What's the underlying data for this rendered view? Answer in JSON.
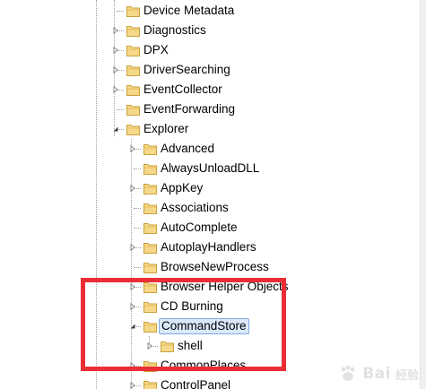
{
  "tree": {
    "top_level_items": [
      {
        "label": "Device Metadata",
        "expander": "none"
      },
      {
        "label": "Diagnostics",
        "expander": "collapsed"
      },
      {
        "label": "DPX",
        "expander": "collapsed"
      },
      {
        "label": "DriverSearching",
        "expander": "collapsed"
      },
      {
        "label": "EventCollector",
        "expander": "collapsed"
      },
      {
        "label": "EventForwarding",
        "expander": "none"
      },
      {
        "label": "Explorer",
        "expander": "expanded"
      }
    ],
    "explorer_children": [
      {
        "label": "Advanced",
        "expander": "collapsed"
      },
      {
        "label": "AlwaysUnloadDLL",
        "expander": "none"
      },
      {
        "label": "AppKey",
        "expander": "collapsed"
      },
      {
        "label": "Associations",
        "expander": "none"
      },
      {
        "label": "AutoComplete",
        "expander": "none"
      },
      {
        "label": "AutoplayHandlers",
        "expander": "collapsed"
      },
      {
        "label": "BrowseNewProcess",
        "expander": "none"
      },
      {
        "label": "Browser Helper Objects",
        "expander": "collapsed"
      },
      {
        "label": "CD Burning",
        "expander": "collapsed"
      },
      {
        "label": "CommandStore",
        "expander": "expanded",
        "selected": true
      },
      {
        "label": "CommonPlaces",
        "expander": "collapsed"
      },
      {
        "label": "ControlPanel",
        "expander": "collapsed"
      }
    ],
    "commandstore_children": [
      {
        "label": "shell",
        "expander": "collapsed"
      }
    ]
  },
  "colors": {
    "folder_fill": "#f5d88a",
    "folder_edge": "#c9a23c",
    "selection_fill": "#d9e9fb",
    "selection_border": "#84acdd",
    "annotation_red": "#ea2e35"
  },
  "icons": {
    "folder": "folder-icon",
    "collapsed": "expand-arrow-icon",
    "expanded": "collapse-arrow-icon"
  },
  "watermark": {
    "brand": "Bai",
    "sub": "经验"
  }
}
